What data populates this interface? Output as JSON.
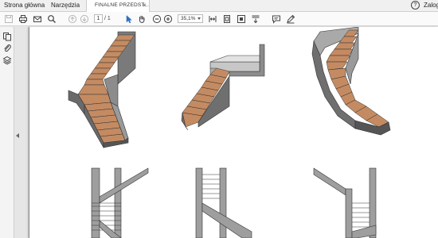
{
  "tabbar": {
    "home_label": "Strona główna",
    "tools_label": "Narzędzia",
    "document_tab": "FINALNE PRZEDST...",
    "close_glyph": "×",
    "help_glyph": "?",
    "login_label": "Zalog"
  },
  "toolbar": {
    "page_current": "1",
    "page_total": "/ 1",
    "zoom": "35,1%",
    "icons": [
      "save-icon",
      "print-icon",
      "email-icon",
      "search-icon",
      "page-up-icon",
      "page-down-icon",
      "select-cursor-icon",
      "hand-tool-icon",
      "zoom-out-icon",
      "zoom-in-icon",
      "fit-width-icon",
      "fit-page-icon",
      "fullscreen-icon",
      "scroll-mode-icon",
      "comment-icon",
      "pen-icon"
    ]
  },
  "sidepanel": {
    "icons": [
      "copy-pages-icon",
      "attachment-icon",
      "layers-icon"
    ]
  },
  "colors": {
    "tread": "#c48b62",
    "stringer": "#6f6f6f",
    "stringer_light": "#a9a9a9",
    "plan_fill": "#9e9e9e"
  }
}
